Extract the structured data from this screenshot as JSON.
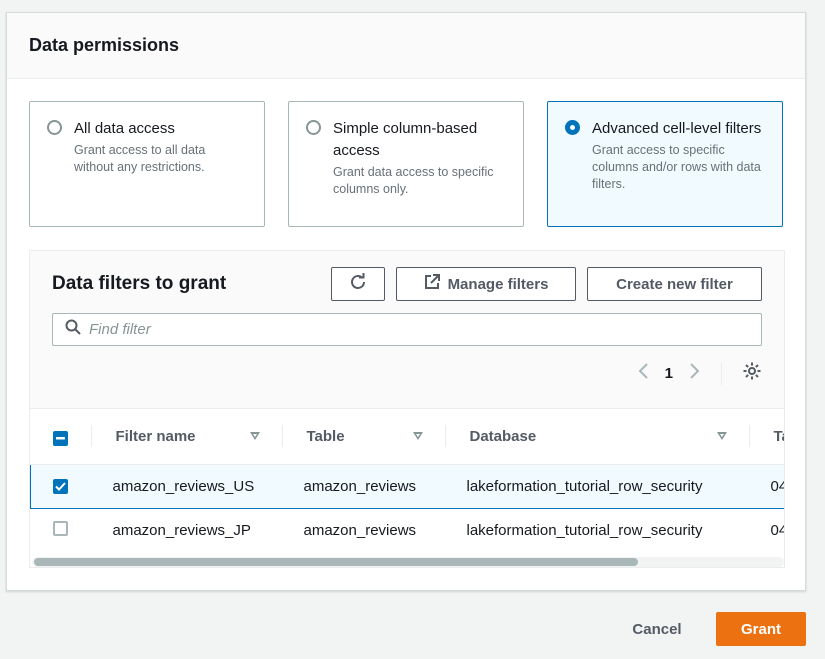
{
  "panel": {
    "title": "Data permissions"
  },
  "access_options": [
    {
      "title": "All data access",
      "description": "Grant access to all data without any restrictions.",
      "selected": false
    },
    {
      "title": "Simple column-based access",
      "description": "Grant data access to specific columns only.",
      "selected": false
    },
    {
      "title": "Advanced cell-level filters",
      "description": "Grant access to specific columns and/or rows with data filters.",
      "selected": true
    }
  ],
  "filters": {
    "title": "Data filters to grant",
    "refresh_icon": "refresh-icon",
    "manage_label": "Manage filters",
    "create_label": "Create new filter",
    "search_placeholder": "Find filter",
    "search_value": "",
    "page": "1",
    "columns": [
      "Filter name",
      "Table",
      "Database",
      "Ta"
    ],
    "rows": [
      {
        "name": "amazon_reviews_US",
        "table": "amazon_reviews",
        "database": "lakeformation_tutorial_row_security",
        "extra": "04",
        "selected": true
      },
      {
        "name": "amazon_reviews_JP",
        "table": "amazon_reviews",
        "database": "lakeformation_tutorial_row_security",
        "extra": "04",
        "selected": false
      }
    ]
  },
  "footer": {
    "cancel_label": "Cancel",
    "grant_label": "Grant"
  },
  "colors": {
    "accent": "#0073bb",
    "primary_button": "#ec7211",
    "selected_bg": "#f1faff"
  }
}
